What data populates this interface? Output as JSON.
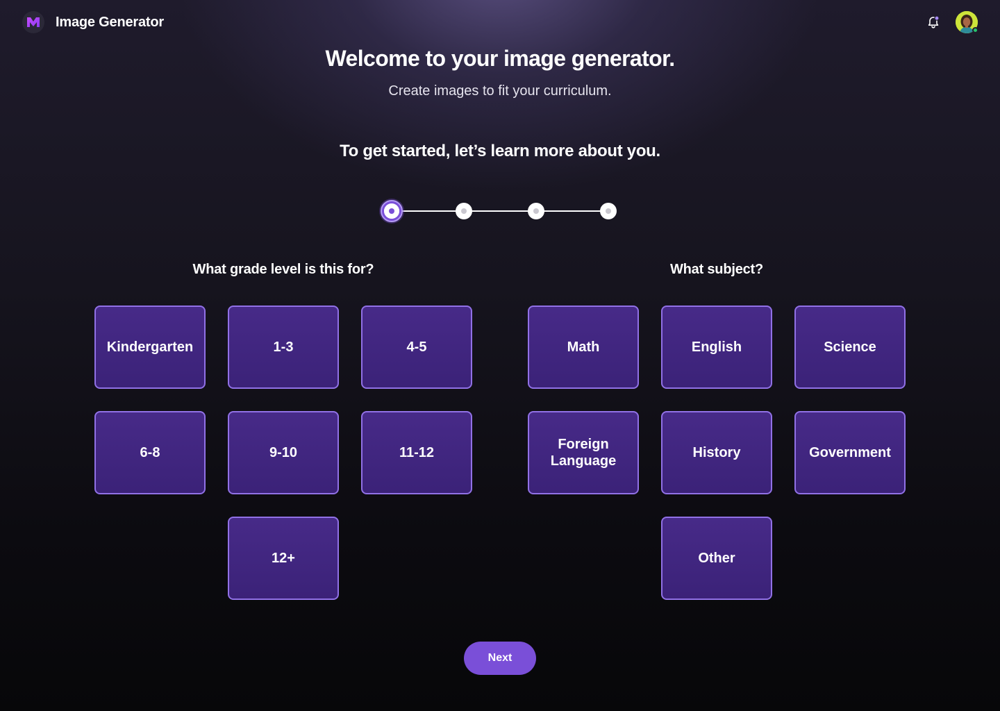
{
  "header": {
    "app_title": "Image Generator",
    "logo_icon": "m-logo-icon",
    "notification_icon": "bell-icon",
    "avatar_icon": "user-avatar",
    "has_unread_notification": true,
    "avatar_online": true
  },
  "intro": {
    "welcome": "Welcome to your image generator.",
    "subtitle": "Create images to fit your curriculum.",
    "prompt": "To get started, let’s learn more about you."
  },
  "stepper": {
    "total_steps": 4,
    "current_step": 1
  },
  "grade": {
    "label": "What grade level is this for?",
    "options": [
      "Kindergarten",
      "1-3",
      "4-5",
      "6-8",
      "9-10",
      "11-12",
      "12+"
    ]
  },
  "subject": {
    "label": "What subject?",
    "options": [
      "Math",
      "English",
      "Science",
      "Foreign Language",
      "History",
      "Government",
      "Other"
    ]
  },
  "footer": {
    "next_label": "Next"
  },
  "colors": {
    "accent": "#7a4fd8",
    "tile_fill": "#432783",
    "tile_border": "#9171e6",
    "notification_dot": "#a78bfa",
    "online_dot": "#27c46b"
  }
}
